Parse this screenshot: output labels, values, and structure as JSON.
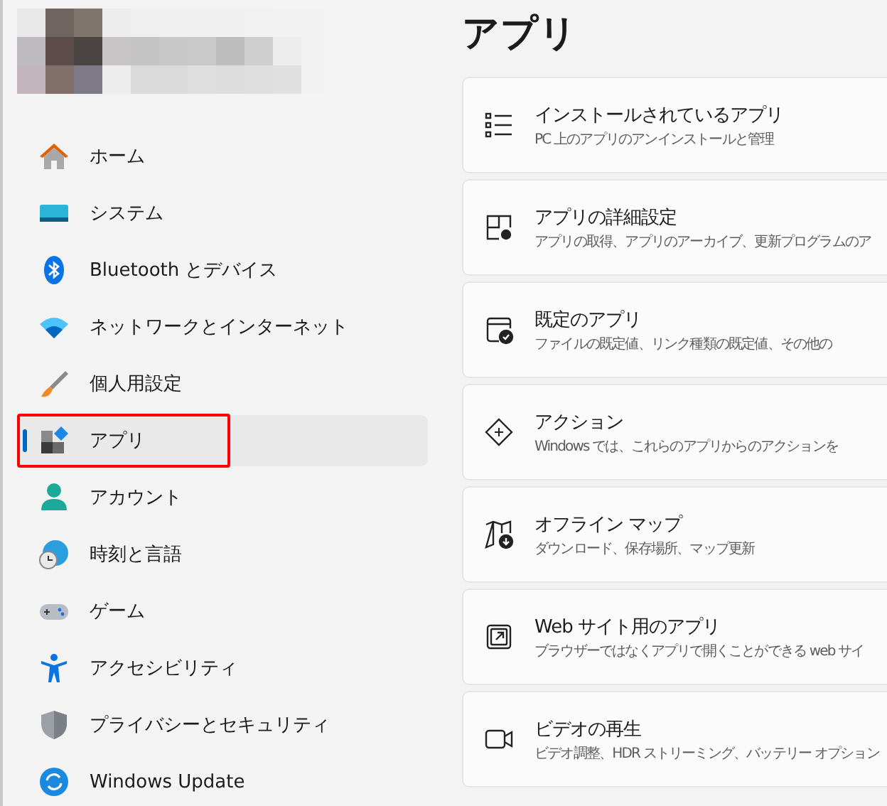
{
  "sidebar": {
    "items": [
      {
        "label": "ホーム",
        "selected": false,
        "highlighted": false
      },
      {
        "label": "システム",
        "selected": false,
        "highlighted": false
      },
      {
        "label": "Bluetooth とデバイス",
        "selected": false,
        "highlighted": false
      },
      {
        "label": "ネットワークとインターネット",
        "selected": false,
        "highlighted": false
      },
      {
        "label": "個人用設定",
        "selected": false,
        "highlighted": false
      },
      {
        "label": "アプリ",
        "selected": true,
        "highlighted": true
      },
      {
        "label": "アカウント",
        "selected": false,
        "highlighted": false
      },
      {
        "label": "時刻と言語",
        "selected": false,
        "highlighted": false
      },
      {
        "label": "ゲーム",
        "selected": false,
        "highlighted": false
      },
      {
        "label": "アクセシビリティ",
        "selected": false,
        "highlighted": false
      },
      {
        "label": "プライバシーとセキュリティ",
        "selected": false,
        "highlighted": false
      },
      {
        "label": "Windows Update",
        "selected": false,
        "highlighted": false
      }
    ]
  },
  "page_title": "アプリ",
  "cards": [
    {
      "title": "インストールされているアプリ",
      "description": "PC 上のアプリのアンインストールと管理"
    },
    {
      "title": "アプリの詳細設定",
      "description": "アプリの取得、アプリのアーカイブ、更新プログラムのア"
    },
    {
      "title": "既定のアプリ",
      "description": "ファイルの既定値、リンク種類の既定値、その他の"
    },
    {
      "title": "アクション",
      "description": "Windows では、これらのアプリからのアクションを"
    },
    {
      "title": "オフライン マップ",
      "description": "ダウンロード、保存場所、マップ更新"
    },
    {
      "title": "Web サイト用のアプリ",
      "description": "ブラウザーではなくアプリで開くことができる web サイ"
    },
    {
      "title": "ビデオの再生",
      "description": "ビデオ調整、HDR ストリーミング、バッテリー オプション"
    }
  ]
}
